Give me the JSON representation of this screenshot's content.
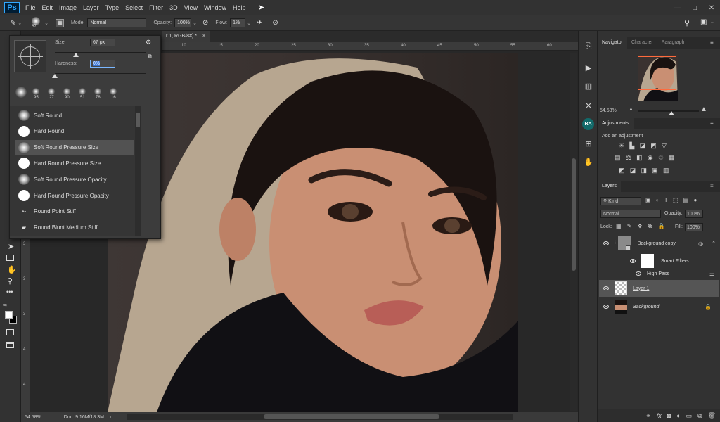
{
  "menu": {
    "logo": "Ps",
    "items": [
      "File",
      "Edit",
      "Image",
      "Layer",
      "Type",
      "Select",
      "Filter",
      "3D",
      "View",
      "Window",
      "Help"
    ],
    "window_controls": [
      "—",
      "□",
      "✕"
    ]
  },
  "options_bar": {
    "brush_size_badge": "67",
    "mode_label": "Mode:",
    "mode_value": "Normal",
    "opacity_label": "Opacity:",
    "opacity_value": "100%",
    "flow_label": "Flow:",
    "flow_value": "1%"
  },
  "brush_picker": {
    "size_label": "Size:",
    "size_value": "67 px",
    "size_level": 0.23,
    "hardness_label": "Hardness:",
    "hardness_value": "0%",
    "hardness_level": 0.0,
    "recent_sizes": [
      "95",
      "27",
      "90",
      "51",
      "78",
      "16"
    ],
    "presets": [
      {
        "name": "Soft Round",
        "kind": "soft",
        "selected": false
      },
      {
        "name": "Hard Round",
        "kind": "hard",
        "selected": false
      },
      {
        "name": "Soft Round Pressure Size",
        "kind": "soft",
        "selected": true
      },
      {
        "name": "Hard Round Pressure Size",
        "kind": "hard",
        "selected": false
      },
      {
        "name": "Soft Round Pressure Opacity",
        "kind": "soft",
        "selected": false
      },
      {
        "name": "Hard Round Pressure Opacity",
        "kind": "hard",
        "selected": false
      },
      {
        "name": "Round Point Stiff",
        "kind": "stiff",
        "selected": false
      },
      {
        "name": "Round Blunt Medium Stiff",
        "kind": "blunt",
        "selected": false
      }
    ]
  },
  "document": {
    "tab_title": "r 1, RGB/8#) *",
    "tab_close": "×",
    "ruler_h": [
      "10",
      "15",
      "20",
      "25",
      "30",
      "35",
      "40",
      "45",
      "50",
      "55",
      "60"
    ],
    "ruler_v": [
      "3",
      "3",
      "3",
      "4",
      "4",
      "4"
    ],
    "zoom": "54.58%",
    "doc_size": "Doc: 9.16M/18.3M"
  },
  "navigator": {
    "tabs": [
      "Navigator",
      "Character",
      "Paragraph"
    ],
    "zoom": "54.58%",
    "zoom_level": 0.55
  },
  "adjustments": {
    "title": "Adjustments",
    "add_label": "Add an adjustment"
  },
  "layers": {
    "title": "Layers",
    "filter_kind": "Kind",
    "blend_mode": "Normal",
    "opacity_label": "Opacity:",
    "opacity_value": "100%",
    "lock_label": "Lock:",
    "fill_label": "Fill:",
    "fill_value": "100%",
    "rows": [
      {
        "name": "Background copy",
        "type": "smart"
      },
      {
        "name": "Smart Filters",
        "type": "filtermask"
      },
      {
        "name": "High Pass",
        "type": "filter"
      },
      {
        "name": "Layer 1",
        "type": "transparent",
        "selected": true
      },
      {
        "name": "Background",
        "type": "photo",
        "locked": true
      }
    ]
  },
  "colors": {
    "highlight": "#ff6b3d",
    "accent_blue": "#31a8ff"
  }
}
